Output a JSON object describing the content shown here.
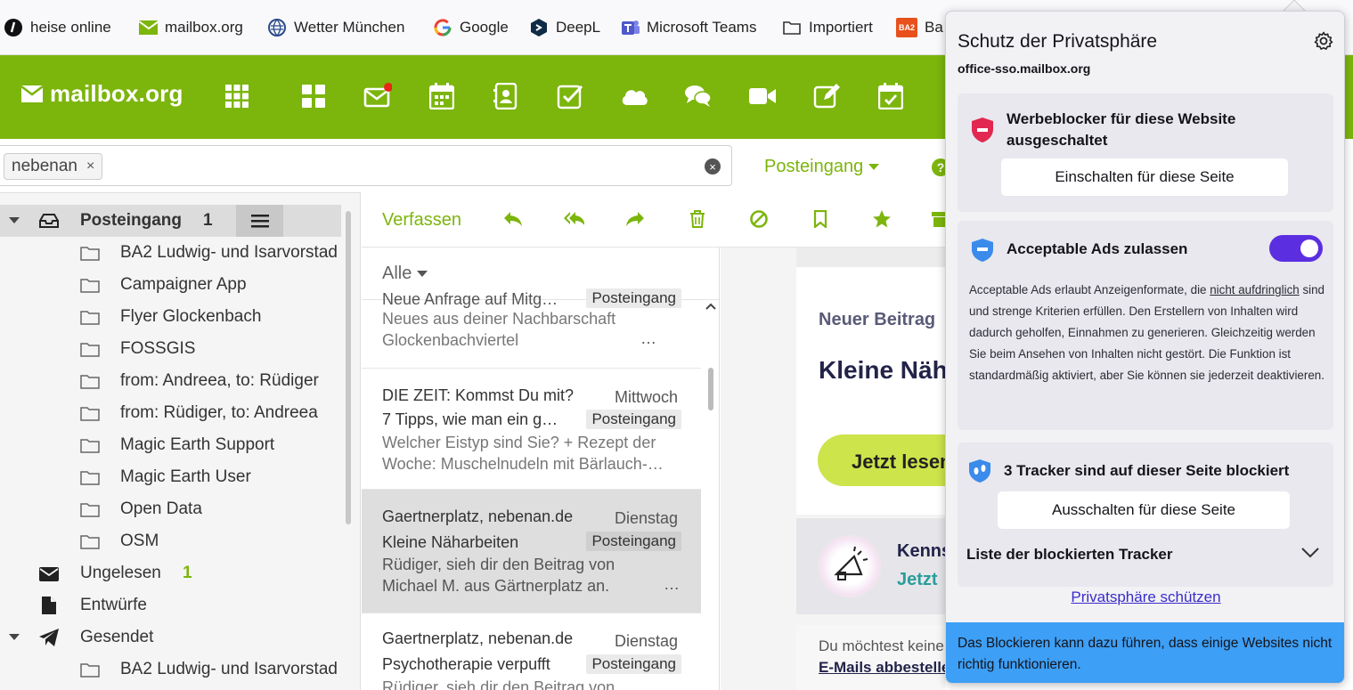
{
  "bookmarks": [
    {
      "icon": "heise-icon",
      "label": "heise online"
    },
    {
      "icon": "mailbox-envelope-icon",
      "label": "mailbox.org"
    },
    {
      "icon": "globe-icon",
      "label": "Wetter München"
    },
    {
      "icon": "google-icon",
      "label": "Google"
    },
    {
      "icon": "deepl-icon",
      "label": "DeepL"
    },
    {
      "icon": "teams-icon",
      "label": "Microsoft Teams"
    },
    {
      "icon": "folder-icon",
      "label": "Importiert"
    },
    {
      "icon": "ba-icon",
      "label": "Ba",
      "icon_text": "BA2"
    }
  ],
  "header": {
    "logo_text": "mailbox.org",
    "brand_color": "#7cb50c",
    "apps": [
      "apps-grid-icon",
      "portal-icon",
      "mail-icon",
      "calendar-icon",
      "contacts-icon",
      "tasks-icon",
      "drive-icon",
      "chat-icon",
      "video-icon",
      "notes-icon",
      "calendar-check-icon"
    ],
    "mail_unread_dot": true
  },
  "search": {
    "chip": "nebenan",
    "chip_close": "×",
    "clear": "×"
  },
  "folder_dropdown": "Posteingang",
  "help_icon": "?",
  "tree": {
    "inbox": {
      "label": "Posteingang",
      "count": "1"
    },
    "subfolders": [
      "BA2 Ludwig- und Isarvorstad",
      "Campaigner App",
      "Flyer Glockenbach",
      "FOSSGIS",
      "from: Andreea, to: Rüdiger",
      "from: Rüdiger, to: Andreea",
      "Magic Earth Support",
      "Magic Earth User",
      "Open Data",
      "OSM"
    ],
    "unread": {
      "label": "Ungelesen",
      "count": "1"
    },
    "drafts": {
      "label": "Entwürfe"
    },
    "sent": {
      "label": "Gesendet"
    },
    "sent_sub": "BA2 Ludwig- und Isarvorstad"
  },
  "toolbar": {
    "compose": "Verfassen",
    "actions": [
      "reply-icon",
      "reply-all-icon",
      "forward-icon",
      "delete-icon",
      "spam-icon",
      "flag-icon",
      "star-icon",
      "archive-icon"
    ]
  },
  "list": {
    "filter": "Alle",
    "items": [
      {
        "from": "Neue Anfrage auf Mitg…",
        "badge": "Posteingang",
        "preview": "Neues aus deiner Nachbarschaft Glockenbachviertel",
        "dots": "…"
      },
      {
        "from": "DIE ZEIT: Kommst Du mit?",
        "date": "Mittwoch",
        "subject": "7 Tipps, wie man ein g…",
        "badge": "Posteingang",
        "preview": "Welcher Eistyp sind Sie? + Rezept der Woche: Muschelnudeln mit Bärlauch-…"
      },
      {
        "from": "Gaertnerplatz, nebenan.de",
        "date": "Dienstag",
        "subject": "Kleine Näharbeiten",
        "badge": "Posteingang",
        "preview": "Rüdiger, sieh dir den Beitrag von Michael M. aus Gärtnerplatz an.",
        "dots": "…"
      },
      {
        "from": "Gaertnerplatz, nebenan.de",
        "date": "Dienstag",
        "subject": "Psychotherapie verpufft",
        "badge": "Posteingang",
        "preview": "Rüdiger, sieh dir den Beitrag von"
      }
    ]
  },
  "reading": {
    "neuer": "Neuer Beitrag",
    "title": "Kleine Näharbeiten",
    "cta": "Jetzt lesen",
    "kenn": "Kennst",
    "jetzt": "Jetzt",
    "footer_text": "Du möchtest keine",
    "unsubscribe": "E-Mails abbestellen"
  },
  "popup": {
    "title": "Schutz der Privatsphäre",
    "site": "office-sso.mailbox.org",
    "adblock": {
      "heading": "Werbeblocker für diese Website ausgeschaltet",
      "button": "Einschalten für diese Seite"
    },
    "aa": {
      "heading": "Acceptable Ads zulassen",
      "toggle_on": true,
      "text_before": "Acceptable Ads erlaubt Anzeigenformate, die ",
      "text_link": "nicht aufdringlich",
      "text_after": " sind und strenge Kriterien erfüllen. Den Erstellern von Inhalten wird dadurch geholfen, Einnahmen zu generieren. Gleichzeitig werden Sie beim Ansehen von Inhalten nicht gestört. Die Funktion ist standardmäßig aktiviert, aber Sie können sie jederzeit deaktivieren."
    },
    "trackers": {
      "heading": "3 Tracker sind auf dieser Seite blockiert",
      "button": "Ausschalten für diese Seite",
      "list_label": "Liste der blockierten Tracker"
    },
    "link": "Privatsphäre schützen",
    "footer": "Das Blockieren kann dazu führen, dass einige Websites nicht richtig funktionieren.",
    "accent": "#5b2ee0",
    "footer_color": "#3d9ff6"
  }
}
